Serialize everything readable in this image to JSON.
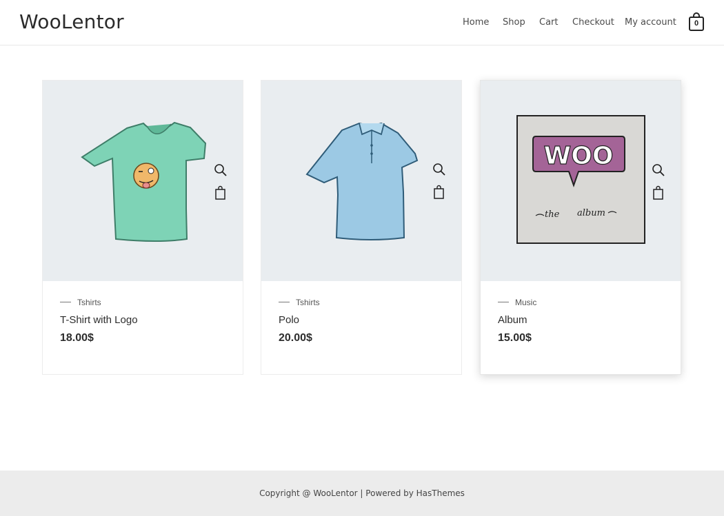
{
  "site": {
    "logo": "WooLentor"
  },
  "nav": {
    "items": [
      {
        "label": "Home"
      },
      {
        "label": "Shop"
      },
      {
        "label": "Cart"
      },
      {
        "label": "Checkout"
      },
      {
        "label": "My account"
      }
    ],
    "cart_count": "0"
  },
  "products": [
    {
      "category": "Tshirts",
      "title": "T-Shirt with Logo",
      "price": "18.00$",
      "image": "tshirt-with-logo",
      "image_bg": "#e9edf0"
    },
    {
      "category": "Tshirts",
      "title": "Polo",
      "price": "20.00$",
      "image": "polo-shirt",
      "image_bg": "#e9edf0"
    },
    {
      "category": "Music",
      "title": "Album",
      "price": "15.00$",
      "image": "woo-album-cover",
      "image_bg": "#e9edf0"
    }
  ],
  "icons": {
    "quick_view": "magnifier-icon",
    "add_to_cart": "shopping-bag-icon"
  },
  "footer": {
    "text": "Copyright @ WooLentor | Powered by HasThemes"
  }
}
